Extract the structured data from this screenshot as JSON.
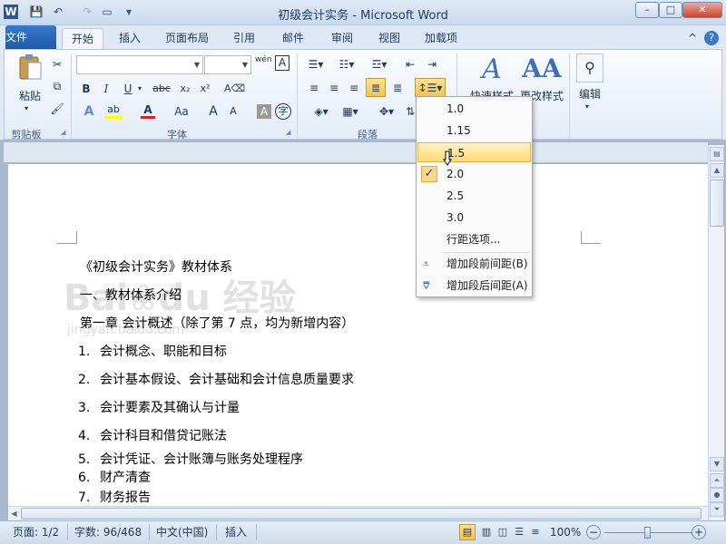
{
  "window": {
    "title": "初级会计实务 - Microsoft Word",
    "minimize": "–",
    "maximize": "□",
    "close": "✕"
  },
  "qat": {
    "word_icon": "W",
    "save_icon": "💾",
    "undo_icon": "↶",
    "redo_icon": "↷",
    "new_icon": "▭",
    "customize_icon": "▾"
  },
  "tabs": {
    "file": "文件",
    "items": [
      "开始",
      "插入",
      "页面布局",
      "引用",
      "邮件",
      "审阅",
      "视图",
      "加载项"
    ],
    "help": "?",
    "collapse": "^"
  },
  "ribbon": {
    "clipboard": {
      "label": "剪贴板",
      "paste": "粘贴"
    },
    "font": {
      "label": "字体",
      "font_name": "",
      "font_size": "",
      "bold": "B",
      "italic": "I",
      "underline": "U",
      "strike": "abc",
      "subscript": "x₂",
      "superscript": "x²",
      "font_color_letter": "A",
      "change_case": "Aa",
      "grow": "A",
      "shrink": "A",
      "char_shade": "A",
      "phonetic": "wén",
      "char_border": "A",
      "enclose": "字"
    },
    "paragraph": {
      "label": "段落"
    },
    "styles": {
      "quick_styles": "快速样式",
      "change_styles": "更改样式"
    },
    "editing": {
      "label": "编辑"
    }
  },
  "line_spacing_menu": {
    "options": [
      "1.0",
      "1.15",
      "1.5",
      "2.0",
      "2.5",
      "3.0"
    ],
    "checked": "2.0",
    "hovered": "1.5",
    "more": "行距选项...",
    "add_before": "增加段前间距(B)",
    "add_after": "增加段后间距(A)",
    "check_mark": "✓"
  },
  "document": {
    "title": "《初级会计实务》教材体系",
    "section": "一、教材体系介绍",
    "chapter": "第一章  会计概述（除了第 7 点，均为新增内容）",
    "items": [
      {
        "n": "1.",
        "t": "会计概念、职能和目标"
      },
      {
        "n": "2.",
        "t": "会计基本假设、会计基础和会计信息质量要求"
      },
      {
        "n": "3.",
        "t": "会计要素及其确认与计量"
      },
      {
        "n": "4.",
        "t": "会计科目和借贷记账法"
      },
      {
        "n": "5.",
        "t": "会计凭证、会计账簿与账务处理程序"
      },
      {
        "n": "6.",
        "t": "财产清查"
      },
      {
        "n": "7.",
        "t": "财务报告"
      }
    ]
  },
  "watermark": {
    "brand": "Bai",
    "brand2": "du",
    "text": "经验",
    "url": "jingyan.baidu.com"
  },
  "status": {
    "page": "页面: 1/2",
    "words": "字数: 96/468",
    "language": "中文(中国)",
    "mode": "插入",
    "zoom": "100%",
    "zoom_out": "−",
    "zoom_in": "+"
  }
}
